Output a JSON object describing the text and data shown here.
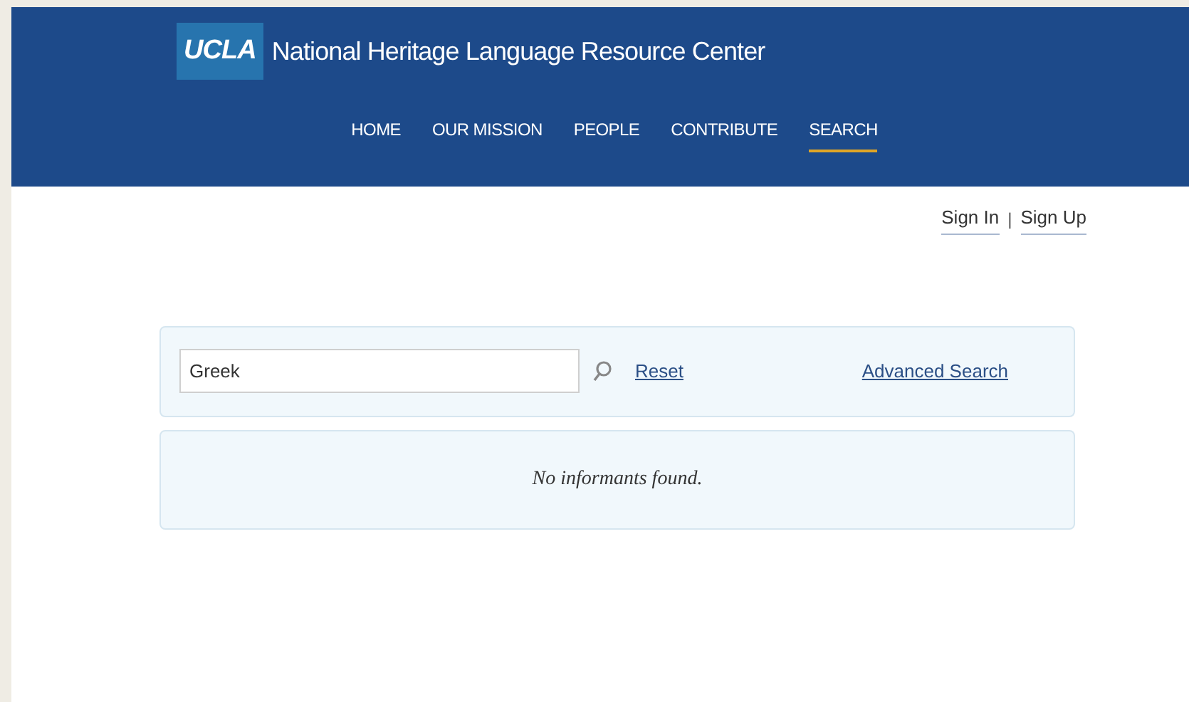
{
  "header": {
    "logo": "UCLA",
    "title": "National Heritage Language Resource Center"
  },
  "nav": [
    {
      "label": "HOME",
      "selected": false
    },
    {
      "label": "OUR MISSION",
      "selected": false
    },
    {
      "label": "PEOPLE",
      "selected": false
    },
    {
      "label": "CONTRIBUTE",
      "selected": false
    },
    {
      "label": "SEARCH",
      "selected": true
    }
  ],
  "account": {
    "sign_in": "Sign In",
    "separator": "|",
    "sign_up": "Sign Up"
  },
  "search": {
    "value": "Greek",
    "reset": "Reset",
    "advanced": "Advanced Search"
  },
  "results": {
    "message": "No informants found."
  }
}
